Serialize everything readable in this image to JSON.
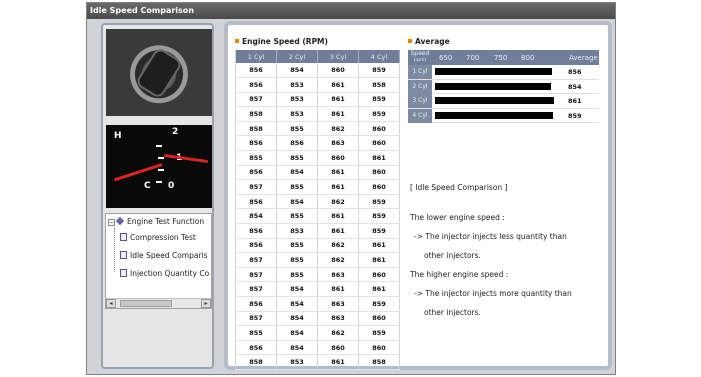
{
  "window": {
    "title": "Idle Speed Comparison"
  },
  "tree": {
    "root": "Engine Test Function",
    "items": [
      "Compression Test",
      "Idle Speed Comparis",
      "Injection Quantity Co"
    ]
  },
  "rpm_table": {
    "title": "Engine Speed (RPM)",
    "headers": [
      "1 Cyl",
      "2 Cyl",
      "3 Cyl",
      "4 Cyl"
    ],
    "rows": [
      [
        "856",
        "854",
        "860",
        "859"
      ],
      [
        "856",
        "853",
        "861",
        "858"
      ],
      [
        "857",
        "853",
        "861",
        "859"
      ],
      [
        "858",
        "853",
        "861",
        "859"
      ],
      [
        "858",
        "855",
        "862",
        "860"
      ],
      [
        "856",
        "856",
        "863",
        "860"
      ],
      [
        "855",
        "855",
        "860",
        "861"
      ],
      [
        "856",
        "854",
        "861",
        "860"
      ],
      [
        "857",
        "855",
        "861",
        "860"
      ],
      [
        "856",
        "854",
        "862",
        "859"
      ],
      [
        "854",
        "855",
        "861",
        "859"
      ],
      [
        "856",
        "853",
        "861",
        "859"
      ],
      [
        "856",
        "855",
        "862",
        "861"
      ],
      [
        "857",
        "855",
        "862",
        "861"
      ],
      [
        "857",
        "855",
        "863",
        "860"
      ],
      [
        "857",
        "854",
        "861",
        "861"
      ],
      [
        "856",
        "854",
        "863",
        "859"
      ],
      [
        "857",
        "854",
        "863",
        "860"
      ],
      [
        "855",
        "854",
        "862",
        "859"
      ],
      [
        "856",
        "854",
        "860",
        "860"
      ],
      [
        "858",
        "853",
        "861",
        "858"
      ]
    ]
  },
  "average": {
    "title": "Average",
    "speed_label": "Speed",
    "speed_unit": "(rpm)",
    "scale": [
      "650",
      "700",
      "750",
      "800"
    ],
    "average_label": "Average",
    "rows": [
      {
        "cyl": "1 Cyl",
        "value": "856"
      },
      {
        "cyl": "2 Cyl",
        "value": "854"
      },
      {
        "cyl": "3 Cyl",
        "value": "861"
      },
      {
        "cyl": "4 Cyl",
        "value": "859"
      }
    ]
  },
  "description": {
    "heading": "[ Idle Speed Comparison ]",
    "lower_title": "The lower engine speed :",
    "lower_line1": "-> The injector injects less quantity than",
    "lower_line2": "other injectors.",
    "higher_title": "The higher engine speed :",
    "higher_line1": "-> The injector injects more quantity than",
    "higher_line2": "other injectors."
  },
  "colors": {
    "header_bg": "#6f7f9a",
    "bullet": "#e08a00",
    "bar": "#000000"
  },
  "icons": {
    "tree_root": "diamond-icon",
    "tree_item": "document-icon"
  }
}
